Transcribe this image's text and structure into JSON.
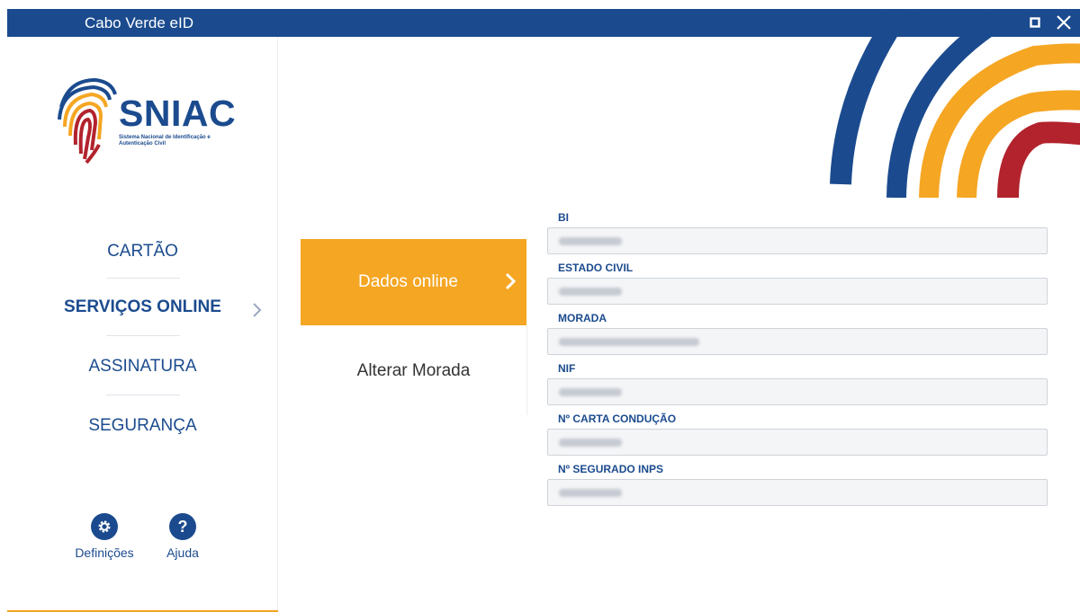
{
  "window": {
    "title": "Cabo Verde eID"
  },
  "logo": {
    "name": "SNIAC",
    "subtitle": "Sistema Nacional de Identificação e Autenticação Civil"
  },
  "nav": {
    "items": [
      {
        "label": "CARTÃO",
        "active": false
      },
      {
        "label": "SERVIÇOS ONLINE",
        "active": true
      },
      {
        "label": "ASSINATURA",
        "active": false
      },
      {
        "label": "SEGURANÇA",
        "active": false
      }
    ]
  },
  "bottom": {
    "settings_label": "Definições",
    "help_label": "Ajuda"
  },
  "submenu": {
    "items": [
      {
        "label": "Dados online",
        "active": true
      },
      {
        "label": "Alterar Morada",
        "active": false
      }
    ]
  },
  "fields": [
    {
      "label": "BI"
    },
    {
      "label": "ESTADO CIVIL"
    },
    {
      "label": "MORADA"
    },
    {
      "label": "NIF"
    },
    {
      "label": "Nº CARTA CONDUÇÃO"
    },
    {
      "label": "Nº SEGURADO INPS"
    }
  ],
  "colors": {
    "primary": "#1b4b8e",
    "accent": "#f5a623",
    "red": "#b2232d"
  },
  "icons": {
    "settings": "gear-icon",
    "help": "question-icon"
  }
}
